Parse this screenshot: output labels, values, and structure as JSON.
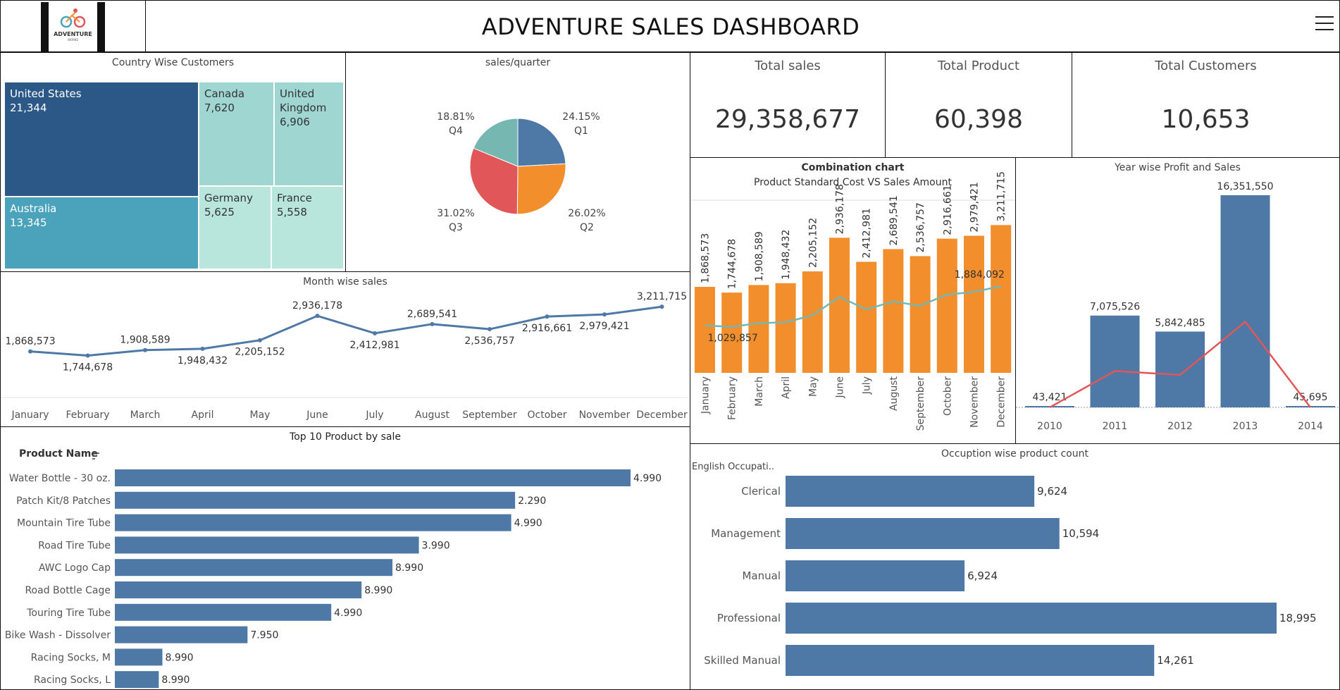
{
  "header": {
    "logo_text": "ADVENTURE",
    "logo_sub": "WORKS",
    "title": "ADVENTURE SALES DASHBOARD"
  },
  "colors": {
    "blue": "#4e79a7",
    "orange": "#f28e2b",
    "red": "#e15759",
    "teal": "#76b7b2",
    "dark_blue": "#2c5888",
    "mid_teal": "#4aa3bb",
    "light_teal": "#9fd6d2",
    "pale_teal": "#b8e6dd"
  },
  "kpis": [
    {
      "label": "Total sales",
      "value": "29,358,677"
    },
    {
      "label": "Total Product",
      "value": "60,398"
    },
    {
      "label": "Total Customers",
      "value": "10,653"
    }
  ],
  "treemap": {
    "title": "Country Wise Customers",
    "cells": [
      {
        "name": "United States",
        "value": "21,344"
      },
      {
        "name": "Australia",
        "value": "13,345"
      },
      {
        "name": "Canada",
        "value": "7,620"
      },
      {
        "name": "United Kingdom",
        "value": "6,906"
      },
      {
        "name": "Germany",
        "value": "5,625"
      },
      {
        "name": "France",
        "value": "5,558"
      }
    ]
  },
  "pie": {
    "title": "sales/quarter",
    "slices": [
      {
        "label": "Q1",
        "pct": "24.15%",
        "value": 24.15
      },
      {
        "label": "Q2",
        "pct": "26.02%",
        "value": 26.02
      },
      {
        "label": "Q3",
        "pct": "31.02%",
        "value": 31.02
      },
      {
        "label": "Q4",
        "pct": "18.81%",
        "value": 18.81
      }
    ]
  },
  "month_line": {
    "title": "Month wise sales",
    "months": [
      "January",
      "February",
      "March",
      "April",
      "May",
      "June",
      "July",
      "August",
      "September",
      "October",
      "November",
      "December"
    ],
    "labels": [
      "1,868,573",
      "1,744,678",
      "1,908,589",
      "1,948,432",
      "2,205,152",
      "2,936,178",
      "2,412,981",
      "2,689,541",
      "2,536,757",
      "2,916,661",
      "2,979,421",
      "3,211,715"
    ],
    "values": [
      1868573,
      1744678,
      1908589,
      1948432,
      2205152,
      2936178,
      2412981,
      2689541,
      2536757,
      2916661,
      2979421,
      3211715
    ]
  },
  "combo": {
    "title_line1": "Combination chart",
    "title_line2": "Product Standard Cost VS Sales Amount",
    "months": [
      "January",
      "February",
      "March",
      "April",
      "May",
      "June",
      "July",
      "August",
      "September",
      "October",
      "November",
      "December"
    ],
    "sales_labels": [
      "1,868,573",
      "1,744,678",
      "1,908,589",
      "1,948,432",
      "2,205,152",
      "2,936,178",
      "2,412,981",
      "2,689,541",
      "2,536,757",
      "2,916,661",
      "2,979,421",
      "3,211,715"
    ],
    "sales": [
      1868573,
      1744678,
      1908589,
      1948432,
      2205152,
      2936178,
      2412981,
      2689541,
      2536757,
      2916661,
      2979421,
      3211715
    ],
    "cost": [
      1029857,
      1000000,
      1080000,
      1100000,
      1250000,
      1650000,
      1380000,
      1550000,
      1460000,
      1700000,
      1760000,
      1884092
    ],
    "cost_annotations": [
      {
        "index": 0,
        "text": "1,029,857"
      },
      {
        "index": 11,
        "text": "1,884,092"
      }
    ]
  },
  "year_chart": {
    "title": "Year wise Profit and Sales",
    "years": [
      "2010",
      "2011",
      "2012",
      "2013",
      "2014"
    ],
    "sales_labels": [
      "43,421",
      "7,075,526",
      "5,842,485",
      "16,351,550",
      "45,695"
    ],
    "sales": [
      43421,
      7075526,
      5842485,
      16351550,
      45695
    ],
    "profit": [
      0,
      2800000,
      2500000,
      6600000,
      0
    ]
  },
  "top_products": {
    "title": "Top 10 Product by sale",
    "axis_label": "Product Name",
    "items": [
      {
        "name": "Water Bottle - 30 oz.",
        "label": "4.990",
        "value": 4.99
      },
      {
        "name": "Patch Kit/8 Patches",
        "label": "2.290",
        "value": 2.29
      },
      {
        "name": "Mountain Tire Tube",
        "label": "4.990",
        "value": 4.99
      },
      {
        "name": "Road Tire Tube",
        "label": "3.990",
        "value": 3.99
      },
      {
        "name": "AWC Logo Cap",
        "label": "8.990",
        "value": 8.99
      },
      {
        "name": "Road Bottle Cage",
        "label": "8.990",
        "value": 8.99
      },
      {
        "name": "Touring Tire Tube",
        "label": "4.990",
        "value": 4.99
      },
      {
        "name": "Bike Wash - Dissolver",
        "label": "7.950",
        "value": 7.95
      },
      {
        "name": "Racing Socks, M",
        "label": "8.990",
        "value": 8.99
      },
      {
        "name": "Racing Socks, L",
        "label": "8.990",
        "value": 8.99
      }
    ],
    "bar_units": [
      18540,
      14390,
      14250,
      10930,
      9980,
      8870,
      7780,
      4770,
      1710,
      1580
    ]
  },
  "occupation": {
    "title": "Occuption wise product count",
    "axis_label": "English Occupati..",
    "items": [
      {
        "name": "Clerical",
        "label": "9,624",
        "value": 9624
      },
      {
        "name": "Management",
        "label": "10,594",
        "value": 10594
      },
      {
        "name": "Manual",
        "label": "6,924",
        "value": 6924
      },
      {
        "name": "Professional",
        "label": "18,995",
        "value": 18995
      },
      {
        "name": "Skilled Manual",
        "label": "14,261",
        "value": 14261
      }
    ]
  },
  "chart_data": [
    {
      "type": "treemap",
      "title": "Country Wise Customers",
      "categories": [
        "United States",
        "Australia",
        "Canada",
        "United Kingdom",
        "Germany",
        "France"
      ],
      "values": [
        21344,
        13345,
        7620,
        6906,
        5625,
        5558
      ]
    },
    {
      "type": "pie",
      "title": "sales/quarter",
      "categories": [
        "Q1",
        "Q2",
        "Q3",
        "Q4"
      ],
      "values": [
        24.15,
        26.02,
        31.02,
        18.81
      ]
    },
    {
      "type": "line",
      "title": "Month wise sales",
      "categories": [
        "January",
        "February",
        "March",
        "April",
        "May",
        "June",
        "July",
        "August",
        "September",
        "October",
        "November",
        "December"
      ],
      "values": [
        1868573,
        1744678,
        1908589,
        1948432,
        2205152,
        2936178,
        2412981,
        2689541,
        2536757,
        2916661,
        2979421,
        3211715
      ]
    },
    {
      "type": "bar",
      "title": "Combination chart Product Standard Cost VS Sales Amount",
      "categories": [
        "January",
        "February",
        "March",
        "April",
        "May",
        "June",
        "July",
        "August",
        "September",
        "October",
        "November",
        "December"
      ],
      "series": [
        {
          "name": "Sales Amount",
          "values": [
            1868573,
            1744678,
            1908589,
            1948432,
            2205152,
            2936178,
            2412981,
            2689541,
            2536757,
            2916661,
            2979421,
            3211715
          ]
        },
        {
          "name": "Product Standard Cost",
          "values": [
            1029857,
            1000000,
            1080000,
            1100000,
            1250000,
            1650000,
            1380000,
            1550000,
            1460000,
            1700000,
            1760000,
            1884092
          ]
        }
      ]
    },
    {
      "type": "bar",
      "title": "Year wise Profit and Sales",
      "categories": [
        "2010",
        "2011",
        "2012",
        "2013",
        "2014"
      ],
      "series": [
        {
          "name": "Sales",
          "values": [
            43421,
            7075526,
            5842485,
            16351550,
            45695
          ]
        },
        {
          "name": "Profit",
          "values": [
            0,
            2800000,
            2500000,
            6600000,
            0
          ]
        }
      ]
    },
    {
      "type": "bar",
      "title": "Top 10 Product by sale",
      "categories": [
        "Water Bottle - 30 oz.",
        "Patch Kit/8 Patches",
        "Mountain Tire Tube",
        "Road Tire Tube",
        "AWC Logo Cap",
        "Road Bottle Cage",
        "Touring Tire Tube",
        "Bike Wash - Dissolver",
        "Racing Socks, M",
        "Racing Socks, L"
      ],
      "values": [
        4.99,
        2.29,
        4.99,
        3.99,
        8.99,
        8.99,
        4.99,
        7.95,
        8.99,
        8.99
      ]
    },
    {
      "type": "bar",
      "title": "Occuption wise product count",
      "categories": [
        "Clerical",
        "Management",
        "Manual",
        "Professional",
        "Skilled Manual"
      ],
      "values": [
        9624,
        10594,
        6924,
        18995,
        14261
      ]
    }
  ]
}
